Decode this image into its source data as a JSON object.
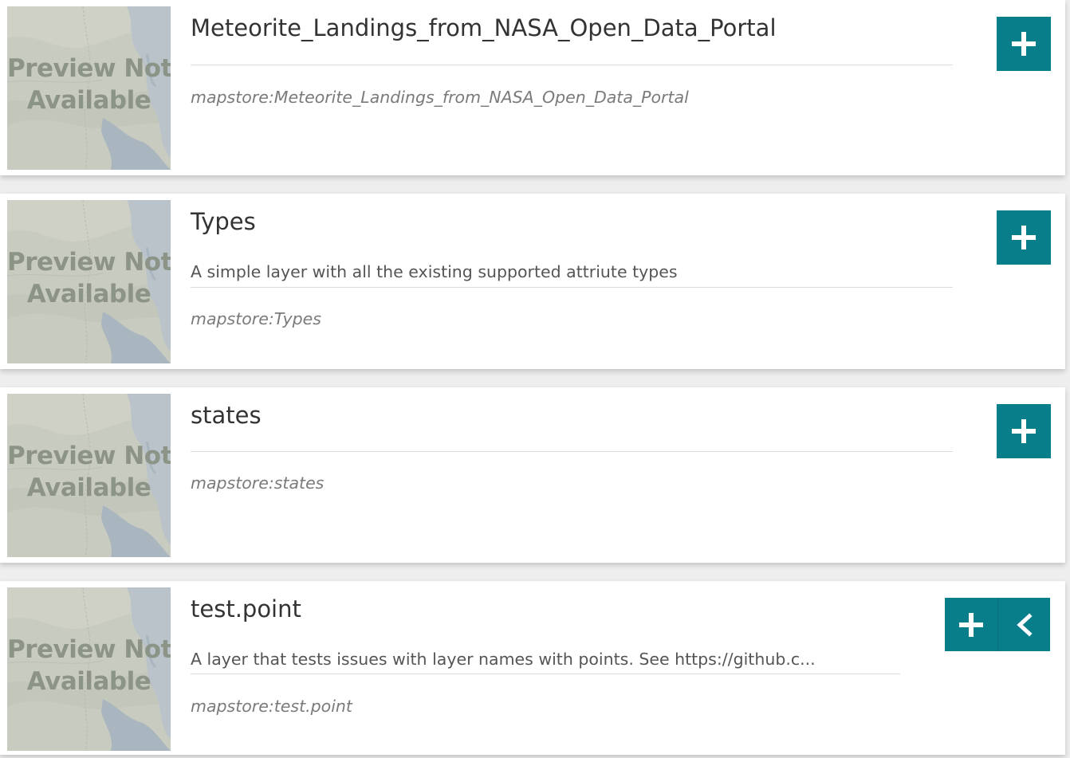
{
  "thumbnail": {
    "line1": "Preview Not",
    "line2": "Available"
  },
  "records": [
    {
      "title": "Meteorite_Landings_from_NASA_Open_Data_Portal",
      "description": "",
      "identifier": "mapstore:Meteorite_Landings_from_NASA_Open_Data_Portal",
      "buttons": [
        "plus-icon"
      ]
    },
    {
      "title": "Types",
      "description": "A simple layer with all the existing supported attriute types",
      "identifier": "mapstore:Types",
      "buttons": [
        "plus-icon"
      ]
    },
    {
      "title": "states",
      "description": "",
      "identifier": "mapstore:states",
      "buttons": [
        "plus-icon"
      ]
    },
    {
      "title": "test.point",
      "description": "A layer that tests issues with layer names with points. See https://github.c...",
      "identifier": "mapstore:test.point",
      "buttons": [
        "plus-icon",
        "chevron-left-icon"
      ]
    }
  ],
  "colors": {
    "accent": "#087e8b",
    "card_background": "#ffffff",
    "page_background": "#eeeeee"
  }
}
